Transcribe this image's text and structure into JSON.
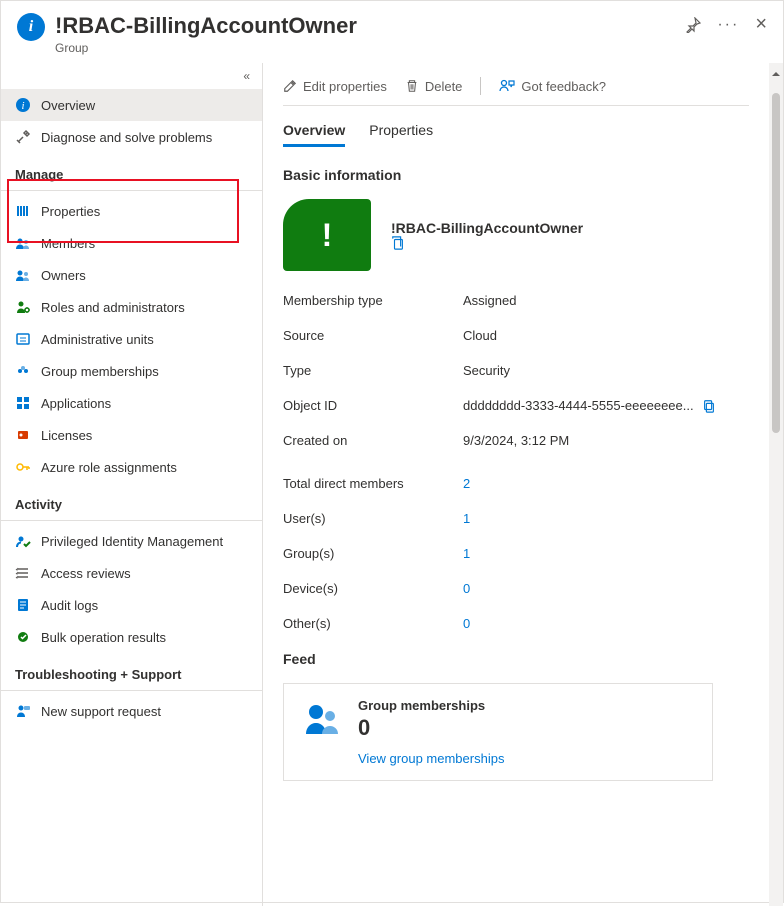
{
  "header": {
    "title": "!RBAC-BillingAccountOwner",
    "subtitle": "Group"
  },
  "sidebar": {
    "collapse": "«",
    "top": [
      {
        "label": "Overview",
        "icon": "info",
        "color": "#0078d4",
        "active": true
      },
      {
        "label": "Diagnose and solve problems",
        "icon": "tools",
        "color": "#605e5c"
      }
    ],
    "sections": [
      {
        "title": "Manage",
        "items": [
          {
            "label": "Properties",
            "icon": "props",
            "color": "#0078d4"
          },
          {
            "label": "Members",
            "icon": "people",
            "color": "#0078d4"
          },
          {
            "label": "Owners",
            "icon": "people",
            "color": "#0078d4"
          },
          {
            "label": "Roles and administrators",
            "icon": "person-gear",
            "color": "#107c10"
          },
          {
            "label": "Administrative units",
            "icon": "admin",
            "color": "#0078d4"
          },
          {
            "label": "Group memberships",
            "icon": "groups",
            "color": "#0078d4"
          },
          {
            "label": "Applications",
            "icon": "apps",
            "color": "#0078d4"
          },
          {
            "label": "Licenses",
            "icon": "license",
            "color": "#d83b01"
          },
          {
            "label": "Azure role assignments",
            "icon": "key",
            "color": "#ffb900"
          }
        ]
      },
      {
        "title": "Activity",
        "items": [
          {
            "label": "Privileged Identity Management",
            "icon": "pim",
            "color": "#0078d4"
          },
          {
            "label": "Access reviews",
            "icon": "reviews",
            "color": "#605e5c"
          },
          {
            "label": "Audit logs",
            "icon": "logs",
            "color": "#0078d4"
          },
          {
            "label": "Bulk operation results",
            "icon": "bulk",
            "color": "#107c10"
          }
        ]
      },
      {
        "title": "Troubleshooting + Support",
        "items": [
          {
            "label": "New support request",
            "icon": "support",
            "color": "#0078d4"
          }
        ]
      }
    ]
  },
  "toolbar": {
    "edit": "Edit properties",
    "delete": "Delete",
    "feedback": "Got feedback?"
  },
  "tabs": [
    {
      "label": "Overview",
      "active": true
    },
    {
      "label": "Properties",
      "active": false
    }
  ],
  "basic": {
    "heading": "Basic information",
    "tile_char": "!",
    "name": "!RBAC-BillingAccountOwner",
    "rows": [
      {
        "k": "Membership type",
        "v": "Assigned"
      },
      {
        "k": "Source",
        "v": "Cloud"
      },
      {
        "k": "Type",
        "v": "Security"
      },
      {
        "k": "Object ID",
        "v": "dddddddd-3333-4444-5555-eeeeeeee...",
        "copy": true
      },
      {
        "k": "Created on",
        "v": "9/3/2024, 3:12 PM"
      }
    ],
    "counts": [
      {
        "k": "Total direct members",
        "v": "2"
      },
      {
        "k": "User(s)",
        "v": "1"
      },
      {
        "k": "Group(s)",
        "v": "1"
      },
      {
        "k": "Device(s)",
        "v": "0"
      },
      {
        "k": "Other(s)",
        "v": "0"
      }
    ]
  },
  "feed": {
    "heading": "Feed",
    "card_title": "Group memberships",
    "card_count": "0",
    "card_link": "View group memberships"
  }
}
